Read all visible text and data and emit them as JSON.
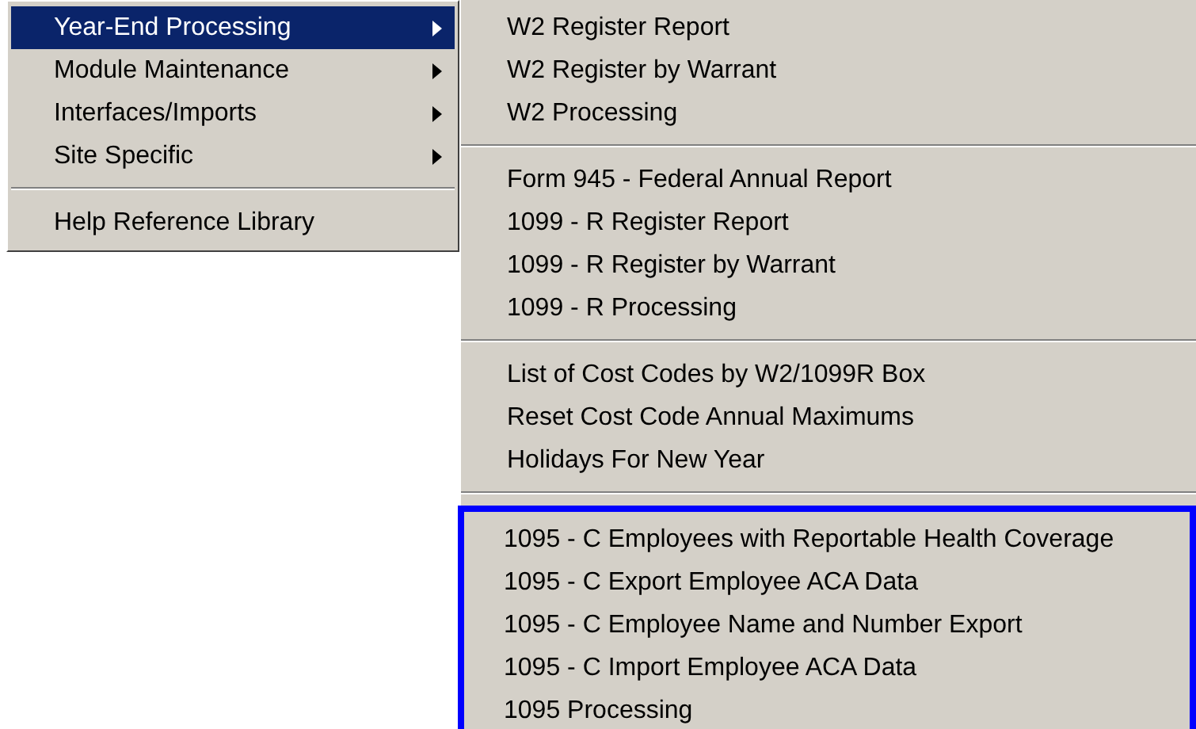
{
  "main_menu": {
    "groups": [
      {
        "items": [
          {
            "label": "Year-End Processing",
            "has_submenu": true,
            "selected": true
          },
          {
            "label": "Module Maintenance",
            "has_submenu": true,
            "selected": false
          },
          {
            "label": "Interfaces/Imports",
            "has_submenu": true,
            "selected": false
          },
          {
            "label": "Site Specific",
            "has_submenu": true,
            "selected": false
          }
        ]
      },
      {
        "items": [
          {
            "label": "Help Reference Library",
            "has_submenu": false,
            "selected": false
          }
        ]
      }
    ]
  },
  "submenu": {
    "groups": [
      {
        "highlighted": false,
        "items": [
          "W2 Register Report",
          "W2 Register by Warrant",
          "W2 Processing"
        ]
      },
      {
        "highlighted": false,
        "items": [
          "Form 945 - Federal Annual Report",
          "1099 - R Register Report",
          "1099 - R Register by Warrant",
          "1099 - R Processing"
        ]
      },
      {
        "highlighted": false,
        "items": [
          "List of Cost Codes by W2/1099R Box",
          "Reset Cost Code Annual Maximums",
          "Holidays For New Year"
        ]
      },
      {
        "highlighted": true,
        "items": [
          "1095 - C Employees with Reportable Health Coverage",
          "1095 - C Export Employee ACA Data",
          "1095 - C Employee Name and Number Export",
          "1095 - C Import Employee ACA Data",
          "1095 Processing"
        ]
      }
    ]
  }
}
